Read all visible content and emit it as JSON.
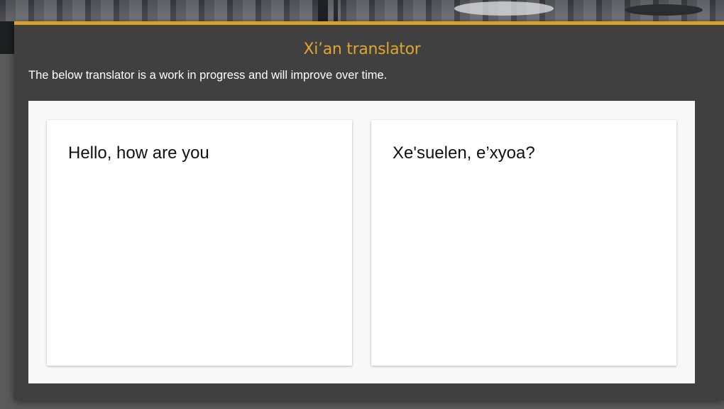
{
  "translator": {
    "title": "Xi’an translator",
    "subtitle": "The below translator is a work in progress and will improve over time.",
    "input": {
      "value": "Hello, how are you"
    },
    "output": {
      "value": "Xe'suelen, e’xyoa?"
    }
  },
  "colors": {
    "accent": "#d8a12a",
    "title": "#dfa52e",
    "panel": "#404040",
    "work_area": "#f8f8f8"
  }
}
